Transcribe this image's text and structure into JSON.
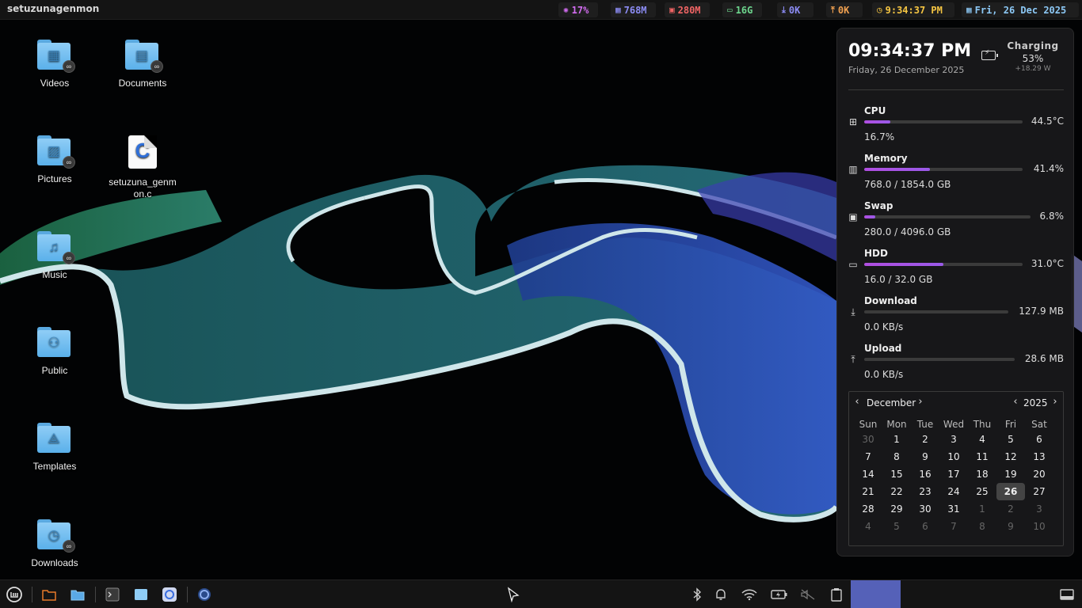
{
  "top_panel": {
    "title": "setuzunagenmon",
    "cpu": "17%",
    "mem": "768M",
    "swap": "280M",
    "hdd": "16G",
    "down": "0K",
    "up": "0K",
    "time": "9:34:37 PM",
    "date": "Fri, 26 Dec 2025",
    "colors": {
      "cpu": "#d26cf0",
      "mem": "#8c8cf5",
      "swap": "#f06464",
      "hdd": "#6cd48c",
      "net": "#f0a050",
      "time": "#f5c542",
      "date": "#8cc8f5"
    }
  },
  "desktop": {
    "icons": [
      {
        "label": "Videos",
        "icon": "video-folder-icon",
        "glyph": "▦"
      },
      {
        "label": "Documents",
        "icon": "documents-folder-icon",
        "glyph": "▤"
      },
      {
        "label": "Pictures",
        "icon": "pictures-folder-icon",
        "glyph": "▨"
      },
      {
        "label": "setuzuna_genmon.c",
        "icon": "c-source-file-icon",
        "glyph": "C"
      },
      {
        "label": "Music",
        "icon": "music-folder-icon",
        "glyph": "♫"
      },
      {
        "label": "Public",
        "icon": "public-folder-icon",
        "glyph": "⚇"
      },
      {
        "label": "Templates",
        "icon": "templates-folder-icon",
        "glyph": "⟁"
      },
      {
        "label": "Downloads",
        "icon": "downloads-folder-icon",
        "glyph": "◷"
      }
    ]
  },
  "sysmon": {
    "time": "09:34:37 PM",
    "date": "Friday, 26 December 2025",
    "charge_state": "Charging",
    "charge_pct": "53%",
    "charge_watt": "+18.29 W",
    "metrics": [
      {
        "name": "CPU",
        "sub": "16.7%",
        "right": "44.5°C",
        "level": 0.167,
        "icon": "cpu-icon"
      },
      {
        "name": "Memory",
        "sub": "768.0 / 1854.0 GB",
        "right": "41.4%",
        "level": 0.414,
        "icon": "memory-icon"
      },
      {
        "name": "Swap",
        "sub": "280.0 / 4096.0 GB",
        "right": "6.8%",
        "level": 0.068,
        "icon": "swap-icon"
      },
      {
        "name": "HDD",
        "sub": "16.0 / 32.0 GB",
        "right": "31.0°C",
        "level": 0.5,
        "icon": "hdd-icon"
      },
      {
        "name": "Download",
        "sub": "0.0 KB/s",
        "right": "127.9 MB",
        "level": 0,
        "icon": "download-icon"
      },
      {
        "name": "Upload",
        "sub": "0.0 KB/s",
        "right": "28.6 MB",
        "level": 0,
        "icon": "upload-icon"
      }
    ]
  },
  "calendar": {
    "month": "December",
    "year": "2025",
    "weekdays": [
      "Sun",
      "Mon",
      "Tue",
      "Wed",
      "Thu",
      "Fri",
      "Sat"
    ],
    "days": [
      [
        "30",
        "1",
        "2",
        "3",
        "4",
        "5",
        "6"
      ],
      [
        "7",
        "8",
        "9",
        "10",
        "11",
        "12",
        "13"
      ],
      [
        "14",
        "15",
        "16",
        "17",
        "18",
        "19",
        "20"
      ],
      [
        "21",
        "22",
        "23",
        "24",
        "25",
        "26",
        "27"
      ],
      [
        "28",
        "29",
        "30",
        "31",
        "1",
        "2",
        "3"
      ],
      [
        "4",
        "5",
        "6",
        "7",
        "8",
        "9",
        "10"
      ]
    ],
    "today": "26"
  },
  "taskbar": {
    "items": [
      {
        "name": "mint-menu-icon",
        "glyph": "ⓜ"
      },
      {
        "name": "files-icon",
        "glyph": "▭"
      },
      {
        "name": "folder-icon",
        "glyph": "▭"
      },
      {
        "name": "terminal-icon",
        "glyph": "▪"
      },
      {
        "name": "file-manager-icon",
        "glyph": "▭"
      },
      {
        "name": "browser-icon",
        "glyph": "◉"
      },
      {
        "name": "app-icon",
        "glyph": "◍"
      }
    ],
    "tray": [
      {
        "name": "bluetooth-icon",
        "glyph": "✱"
      },
      {
        "name": "notifications-icon",
        "glyph": "🔔"
      },
      {
        "name": "wifi-icon",
        "glyph": "◠"
      },
      {
        "name": "battery-icon",
        "glyph": "▭"
      },
      {
        "name": "volume-muted-icon",
        "glyph": "🔇"
      },
      {
        "name": "clipboard-icon",
        "glyph": "▯"
      }
    ]
  }
}
